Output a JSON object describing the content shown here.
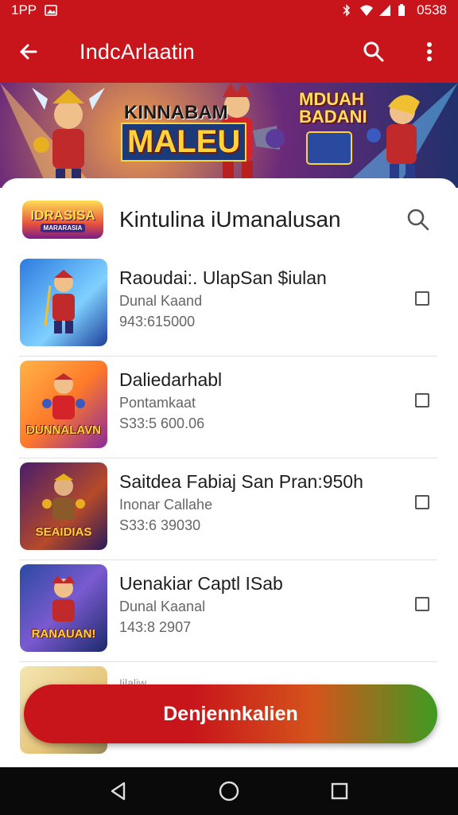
{
  "status_bar": {
    "left_text": "1PP",
    "time": "0538",
    "icons": [
      "gallery-icon",
      "bluetooth-icon",
      "wifi-icon",
      "signal-icon",
      "battery-icon"
    ]
  },
  "app_bar": {
    "title": "IndcArlaatin",
    "icons": [
      "back-arrow-icon",
      "search-icon",
      "more-vert-icon"
    ]
  },
  "banner": {
    "text_line_1": "KINNABAM",
    "text_line_2": "MALEU",
    "text_line_3": "MDUAH",
    "text_line_4": "BADANI"
  },
  "sheet": {
    "logo_line_1": "IDRASISA",
    "logo_line_2": "MARARASIA",
    "title": "Kintulina iUmanalusan",
    "search_icon": "search-icon"
  },
  "items": [
    {
      "title": "Raoudai:. UlapSan $iulan",
      "subtitle": "Dunal Kaand",
      "price": "943:615000",
      "thumb_label": "",
      "checked": false
    },
    {
      "title": "Daliedarhabl",
      "subtitle": "Pontamkaat",
      "price": "S33:5 600.06",
      "thumb_label": "DUNNALAVN",
      "checked": false
    },
    {
      "title": "Saitdea Fabiaj San Pran:950h",
      "subtitle": "Inonar Callahe",
      "price": "S33:6 39030",
      "thumb_label": "SEAIDIAS",
      "checked": false
    },
    {
      "title": "Uenakiar Captl ISab",
      "subtitle": "Dunal Kaanal",
      "price": "143:8 2907",
      "thumb_label": "RANAUAN!",
      "checked": false
    }
  ],
  "partial_item": {
    "text": "Iilaliw"
  },
  "cta": {
    "label": "Denjennkalien"
  },
  "nav_bar": {
    "icons": [
      "back-triangle-icon",
      "home-circle-icon",
      "recents-square-icon"
    ]
  },
  "colors": {
    "primary": "#c8141b",
    "cta_end": "#3e9b22",
    "nav": "#0a0a0a"
  }
}
